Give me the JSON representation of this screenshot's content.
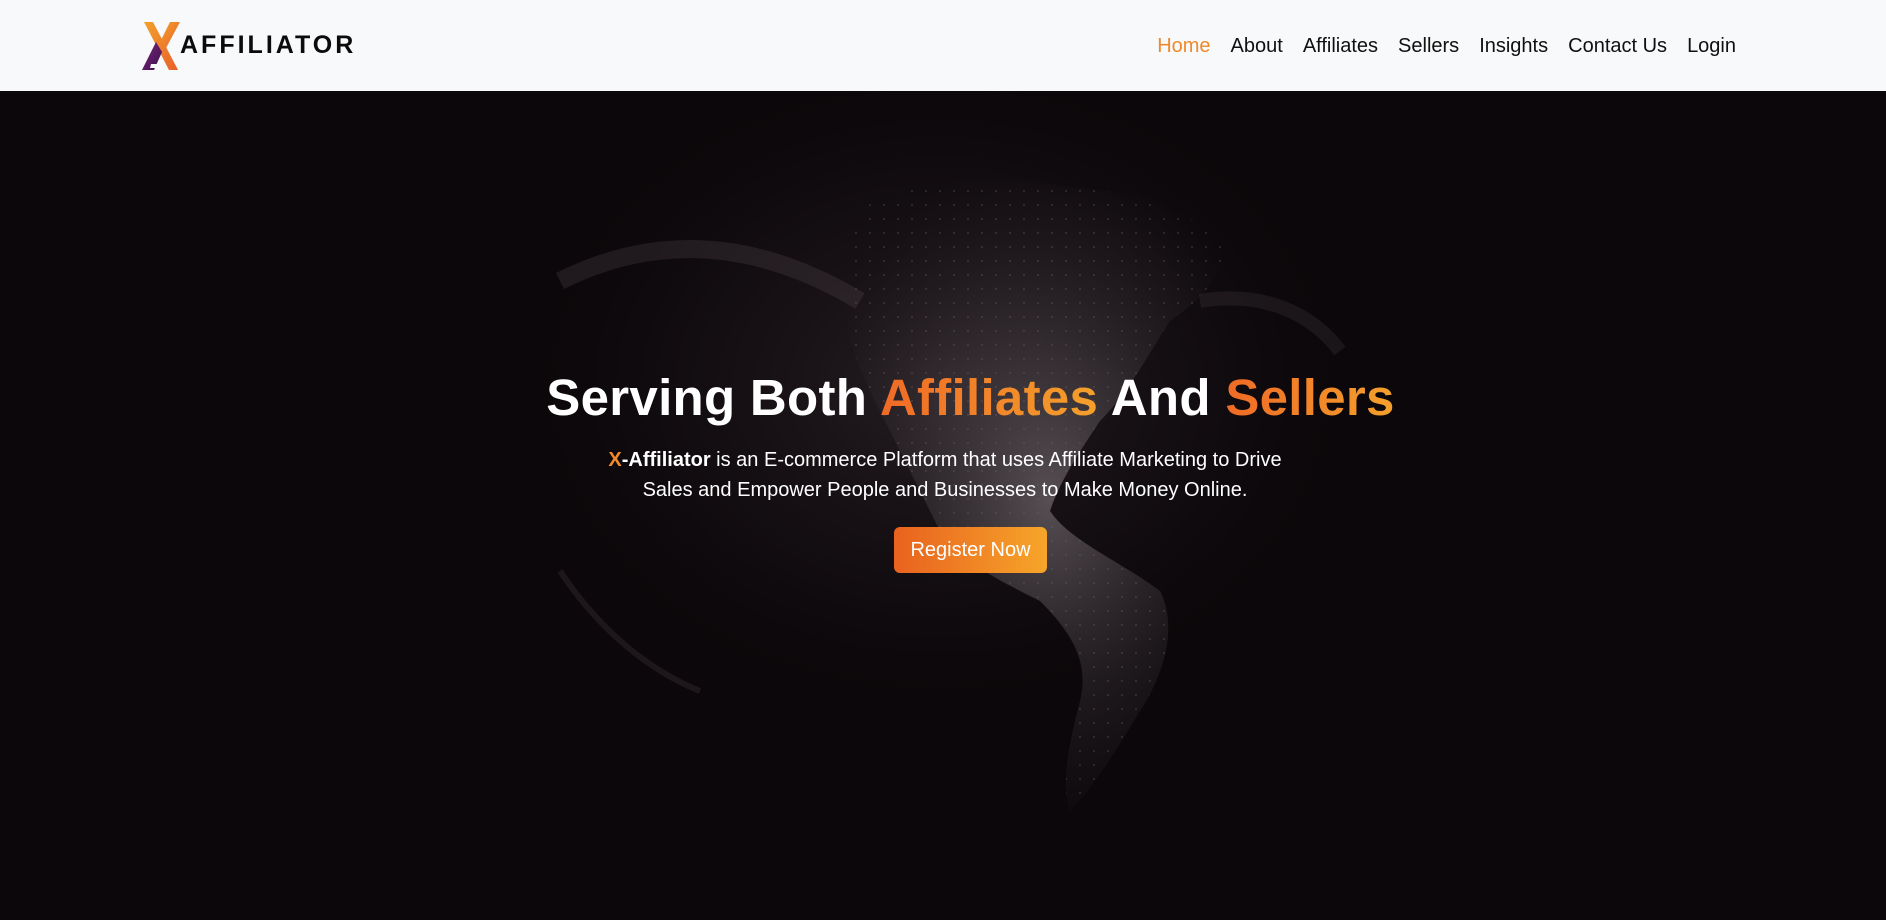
{
  "brand": {
    "logo_text": "AFFILIATOR",
    "logo_icon": "x-affiliator-logo-icon"
  },
  "nav": {
    "items": [
      {
        "label": "Home",
        "active": true
      },
      {
        "label": "About",
        "active": false
      },
      {
        "label": "Affiliates",
        "active": false
      },
      {
        "label": "Sellers",
        "active": false
      },
      {
        "label": "Insights",
        "active": false
      },
      {
        "label": "Contact Us",
        "active": false
      },
      {
        "label": "Login",
        "active": false
      }
    ]
  },
  "hero": {
    "headline": {
      "part1": "Serving Both ",
      "accent1": "Affiliates",
      "part2": " And ",
      "accent2": "Sellers"
    },
    "subtitle": {
      "x": "X",
      "brand": "-Affiliator",
      "line1": " is an E-commerce Platform that uses Affiliate Marketing to Drive",
      "line2": "Sales and Empower People and Businesses to Make Money Online."
    },
    "cta_label": "Register Now",
    "background_icon": "world-map-particles"
  },
  "colors": {
    "accent": "#ef8a2c",
    "accent_gradient_start": "#e9621f",
    "accent_gradient_end": "#f6a52a",
    "navbar_bg": "#f8f9fa",
    "hero_bg": "#0b070a",
    "logo_purple": "#5a1a5e"
  }
}
